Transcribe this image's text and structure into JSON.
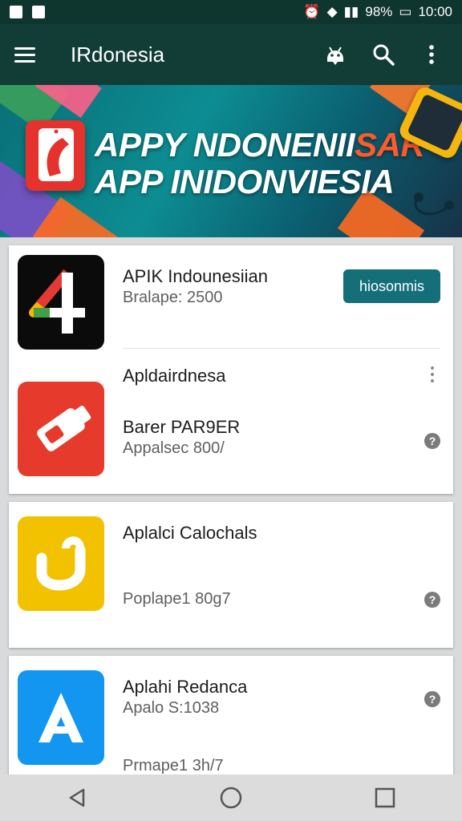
{
  "status_bar": {
    "battery": "98%",
    "time": "10:00"
  },
  "app_bar": {
    "title": "IRdonesia",
    "icons": [
      "menu-icon",
      "android-icon",
      "search-icon",
      "more-vert-icon"
    ]
  },
  "banner": {
    "line1_main": "APPY NDONENII",
    "line1_accent": "SAR",
    "line2": "APP INIDONVIESIA"
  },
  "apps": [
    {
      "name": "APIK Indounesiian",
      "meta": "Bralape: 2500",
      "action": "hiosonmis",
      "icon": "four-logo-icon"
    },
    {
      "name": "Apldairdnesa",
      "meta_title": "Barer PAR9ER",
      "meta": "Appalsec 800/",
      "icon": "usb-icon"
    },
    {
      "name": "Aplalci Calochals",
      "meta": "Poplape1 80g7",
      "icon": "hook-icon"
    },
    {
      "name": "Aplahi Redanca",
      "meta_title": "Apalo S:1038",
      "meta": "Prmape1 3h/7",
      "icon": "letter-a-icon"
    }
  ],
  "colors": {
    "app_bar": "#123d37",
    "status_bar": "#0f352f",
    "install_button": "#146f79"
  }
}
